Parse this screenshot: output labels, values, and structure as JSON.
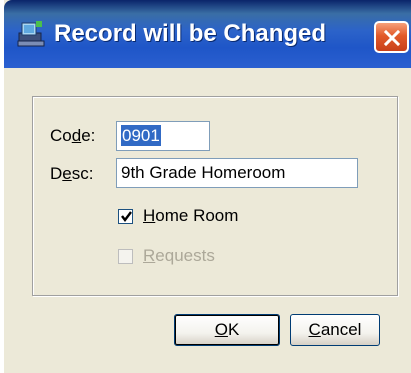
{
  "window": {
    "title": "Record will be Changed"
  },
  "form": {
    "code_label_pre": "Co",
    "code_label_key": "d",
    "code_label_post": "e:",
    "code_value": "0901",
    "desc_label_pre": "D",
    "desc_label_key": "e",
    "desc_label_post": "sc:",
    "desc_value": "9th Grade Homeroom",
    "homeroom_key": "H",
    "homeroom_rest": "ome Room",
    "homeroom_checked": true,
    "requests_key": "R",
    "requests_rest": "equests",
    "requests_checked": false
  },
  "buttons": {
    "ok_key": "O",
    "ok_rest": "K",
    "cancel_key": "C",
    "cancel_rest": "ancel"
  },
  "icons": {
    "app": "computer-icon",
    "close": "close-icon",
    "check": "checkmark-icon"
  },
  "colors": {
    "titlebar": "#245edb",
    "selection": "#316ac5",
    "close_button": "#e25a2a"
  }
}
